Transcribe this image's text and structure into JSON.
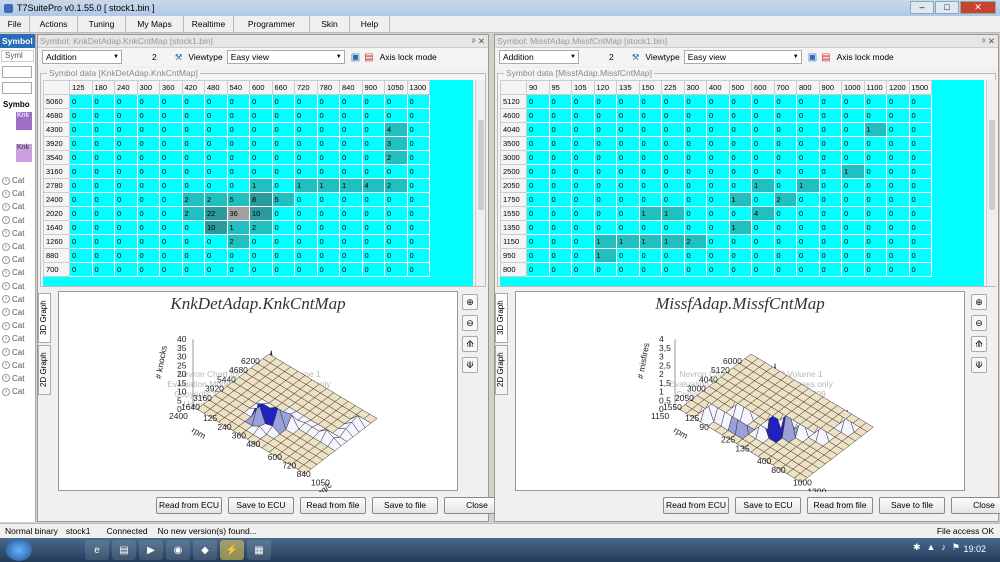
{
  "window": {
    "title": "T7SuitePro v0.1.55.0 [ stock1.bin ]",
    "minimize": "–",
    "maximize": "□",
    "close": "✕"
  },
  "menu": [
    "File",
    "Actions",
    "Tuning",
    "My Maps",
    "Realtime",
    "Programmer",
    "Skin",
    "Help"
  ],
  "sidebar": {
    "header": "Symbol",
    "tab": "Syml",
    "section": "Symbo",
    "item1": "Knk",
    "item2": "Knk",
    "cat_label": "Cat",
    "cat_icon": "chevron-right-icon",
    "cat_count": 17
  },
  "colors": {
    "cell": "#00ffff",
    "cell_mid": "#20c0c0",
    "cell_dark": "#2a9a9a",
    "cell_gray": "#a0a0a0",
    "accent": "#2a6eb7"
  },
  "left": {
    "title": "Symbol: KnkDetAdap.KnkCntMap [stock1.bin]",
    "mode": "Addition",
    "value": "2",
    "viewtype_label": "Viewtype",
    "viewtype": "Easy view",
    "axis_lock": "Axis lock mode",
    "group_label": "Symbol data [KnkDetAdap.KnkCntMap]",
    "columns": [
      "125",
      "180",
      "240",
      "300",
      "360",
      "420",
      "480",
      "540",
      "600",
      "660",
      "720",
      "780",
      "840",
      "900",
      "1050",
      "1300"
    ],
    "rows": [
      {
        "h": "5060",
        "v": [
          "0",
          "0",
          "0",
          "0",
          "0",
          "0",
          "0",
          "0",
          "0",
          "0",
          "0",
          "0",
          "0",
          "0",
          "0",
          "0"
        ]
      },
      {
        "h": "4680",
        "v": [
          "0",
          "0",
          "0",
          "0",
          "0",
          "0",
          "0",
          "0",
          "0",
          "0",
          "0",
          "0",
          "0",
          "0",
          "0",
          "0"
        ]
      },
      {
        "h": "4300",
        "v": [
          "0",
          "0",
          "0",
          "0",
          "0",
          "0",
          "0",
          "0",
          "0",
          "0",
          "0",
          "0",
          "0",
          "0",
          "4",
          "0"
        ]
      },
      {
        "h": "3920",
        "v": [
          "0",
          "0",
          "0",
          "0",
          "0",
          "0",
          "0",
          "0",
          "0",
          "0",
          "0",
          "0",
          "0",
          "0",
          "3",
          "0"
        ]
      },
      {
        "h": "3540",
        "v": [
          "0",
          "0",
          "0",
          "0",
          "0",
          "0",
          "0",
          "0",
          "0",
          "0",
          "0",
          "0",
          "0",
          "0",
          "2",
          "0"
        ]
      },
      {
        "h": "3160",
        "v": [
          "0",
          "0",
          "0",
          "0",
          "0",
          "0",
          "0",
          "0",
          "0",
          "0",
          "0",
          "0",
          "0",
          "0",
          "0",
          "0"
        ]
      },
      {
        "h": "2780",
        "v": [
          "0",
          "0",
          "0",
          "0",
          "0",
          "0",
          "0",
          "0",
          "1",
          "0",
          "1",
          "1",
          "1",
          "4",
          "2",
          "0"
        ]
      },
      {
        "h": "2400",
        "v": [
          "0",
          "0",
          "0",
          "0",
          "0",
          "2",
          "2",
          "5",
          "8",
          "5",
          "0",
          "0",
          "0",
          "0",
          "0",
          "0"
        ]
      },
      {
        "h": "2020",
        "v": [
          "0",
          "0",
          "0",
          "0",
          "0",
          "2",
          "22",
          "36",
          "10",
          "0",
          "0",
          "0",
          "0",
          "0",
          "0",
          "0"
        ]
      },
      {
        "h": "1640",
        "v": [
          "0",
          "0",
          "0",
          "0",
          "0",
          "0",
          "10",
          "1",
          "2",
          "0",
          "0",
          "0",
          "0",
          "0",
          "0",
          "0"
        ]
      },
      {
        "h": "1260",
        "v": [
          "0",
          "0",
          "0",
          "0",
          "0",
          "0",
          "0",
          "2",
          "0",
          "0",
          "0",
          "0",
          "0",
          "0",
          "0",
          "0"
        ]
      },
      {
        "h": "880",
        "v": [
          "0",
          "0",
          "0",
          "0",
          "0",
          "0",
          "0",
          "0",
          "0",
          "0",
          "0",
          "0",
          "0",
          "0",
          "0",
          "0"
        ]
      },
      {
        "h": "700",
        "v": [
          "0",
          "0",
          "0",
          "0",
          "0",
          "0",
          "0",
          "0",
          "0",
          "0",
          "0",
          "0",
          "0",
          "0",
          "0",
          "0"
        ]
      }
    ],
    "graph_title": "KnkDetAdap.KnkCntMap",
    "zlabel": "# knocks",
    "xlabel": "rpm",
    "ylabel": "mg/c",
    "zticks": [
      "40",
      "35",
      "30",
      "25",
      "20",
      "15",
      "10",
      "5",
      "0"
    ],
    "xticks": [
      "6200",
      "4680",
      "5440",
      "3920",
      "3160",
      "1640",
      "2400"
    ],
    "yticks": [
      "1050",
      "840",
      "720",
      "600",
      "480",
      "360",
      "240",
      "125"
    ],
    "tab3d": "3D Graph",
    "tab2d": "2D Graph",
    "buttons": [
      "Read from ECU",
      "Save to ECU",
      "Read from file",
      "Save to file",
      "Close"
    ]
  },
  "right": {
    "title": "Symbol: MissfAdap.MissfCntMap [stock1.bin]",
    "mode": "Addition",
    "value": "2",
    "viewtype_label": "Viewtype",
    "viewtype": "Easy view",
    "axis_lock": "Axis lock mode",
    "group_label": "Symbol data [MissfAdap.MissfCntMap]",
    "columns": [
      "90",
      "95",
      "105",
      "120",
      "135",
      "150",
      "225",
      "300",
      "400",
      "500",
      "600",
      "700",
      "800",
      "900",
      "1000",
      "1100",
      "1200",
      "1500"
    ],
    "rows": [
      {
        "h": "5120",
        "v": [
          "0",
          "0",
          "0",
          "0",
          "0",
          "0",
          "0",
          "0",
          "0",
          "0",
          "0",
          "0",
          "0",
          "0",
          "0",
          "0",
          "0",
          "0"
        ]
      },
      {
        "h": "4600",
        "v": [
          "0",
          "0",
          "0",
          "0",
          "0",
          "0",
          "0",
          "0",
          "0",
          "0",
          "0",
          "0",
          "0",
          "0",
          "0",
          "0",
          "0",
          "0"
        ]
      },
      {
        "h": "4040",
        "v": [
          "0",
          "0",
          "0",
          "0",
          "0",
          "0",
          "0",
          "0",
          "0",
          "0",
          "0",
          "0",
          "0",
          "0",
          "0",
          "1",
          "0",
          "0"
        ]
      },
      {
        "h": "3500",
        "v": [
          "0",
          "0",
          "0",
          "0",
          "0",
          "0",
          "0",
          "0",
          "0",
          "0",
          "0",
          "0",
          "0",
          "0",
          "0",
          "0",
          "0",
          "0"
        ]
      },
      {
        "h": "3000",
        "v": [
          "0",
          "0",
          "0",
          "0",
          "0",
          "0",
          "0",
          "0",
          "0",
          "0",
          "0",
          "0",
          "0",
          "0",
          "0",
          "0",
          "0",
          "0"
        ]
      },
      {
        "h": "2500",
        "v": [
          "0",
          "0",
          "0",
          "0",
          "0",
          "0",
          "0",
          "0",
          "0",
          "0",
          "0",
          "0",
          "0",
          "0",
          "1",
          "0",
          "0",
          "0"
        ]
      },
      {
        "h": "2050",
        "v": [
          "0",
          "0",
          "0",
          "0",
          "0",
          "0",
          "0",
          "0",
          "0",
          "0",
          "1",
          "0",
          "1",
          "0",
          "0",
          "0",
          "0",
          "0"
        ]
      },
      {
        "h": "1750",
        "v": [
          "0",
          "0",
          "0",
          "0",
          "0",
          "0",
          "0",
          "0",
          "0",
          "1",
          "0",
          "2",
          "0",
          "0",
          "0",
          "0",
          "0",
          "0"
        ]
      },
      {
        "h": "1550",
        "v": [
          "0",
          "0",
          "0",
          "0",
          "0",
          "1",
          "1",
          "0",
          "0",
          "0",
          "4",
          "0",
          "0",
          "0",
          "0",
          "0",
          "0",
          "0"
        ]
      },
      {
        "h": "1350",
        "v": [
          "0",
          "0",
          "0",
          "0",
          "0",
          "0",
          "0",
          "0",
          "0",
          "1",
          "0",
          "0",
          "0",
          "0",
          "0",
          "0",
          "0",
          "0"
        ]
      },
      {
        "h": "1150",
        "v": [
          "0",
          "0",
          "0",
          "1",
          "1",
          "1",
          "1",
          "2",
          "0",
          "0",
          "0",
          "0",
          "0",
          "0",
          "0",
          "0",
          "0",
          "0"
        ]
      },
      {
        "h": "950",
        "v": [
          "0",
          "0",
          "0",
          "1",
          "0",
          "0",
          "0",
          "0",
          "0",
          "0",
          "0",
          "0",
          "0",
          "0",
          "0",
          "0",
          "0",
          "0"
        ]
      },
      {
        "h": "800",
        "v": [
          "0",
          "0",
          "0",
          "0",
          "0",
          "0",
          "0",
          "0",
          "0",
          "0",
          "0",
          "0",
          "0",
          "0",
          "0",
          "0",
          "0",
          "0"
        ]
      }
    ],
    "graph_title": "MissfAdap.MissfCntMap",
    "zlabel": "# misfires",
    "xlabel": "rpm",
    "ylabel": "mg/c",
    "zticks": [
      "4",
      "3,5",
      "3",
      "2,5",
      "2",
      "1,5",
      "1",
      "0,5",
      "0"
    ],
    "xticks": [
      "6000",
      "5120",
      "4040",
      "3000",
      "2050",
      "1550",
      "1150"
    ],
    "yticks": [
      "1200",
      "1000",
      "800",
      "400",
      "135",
      "225",
      "90",
      "125"
    ],
    "tab3d": "3D Graph",
    "tab2d": "2D Graph",
    "buttons": [
      "Read from ECU",
      "Save to ECU",
      "Read from file",
      "Save to file",
      "Close"
    ]
  },
  "watermark": [
    "Nevron Chart for .NET 2009 Volume 1",
    "Evaluation Mode - for testing purposes only",
    "Copyright Nevron Software 1998 - 2009",
    "Using function 2009 license edition"
  ],
  "status": {
    "binary": "Normal binary",
    "file": "stock1",
    "conn": "Connected",
    "version": "No new version(s) found...",
    "access": "File access OK"
  },
  "taskbar": {
    "clock": "19:02",
    "pins": [
      "ie-icon",
      "folder-icon",
      "media-icon",
      "chrome-icon",
      "app-icon",
      "t7suite-icon",
      "app2-icon"
    ]
  }
}
